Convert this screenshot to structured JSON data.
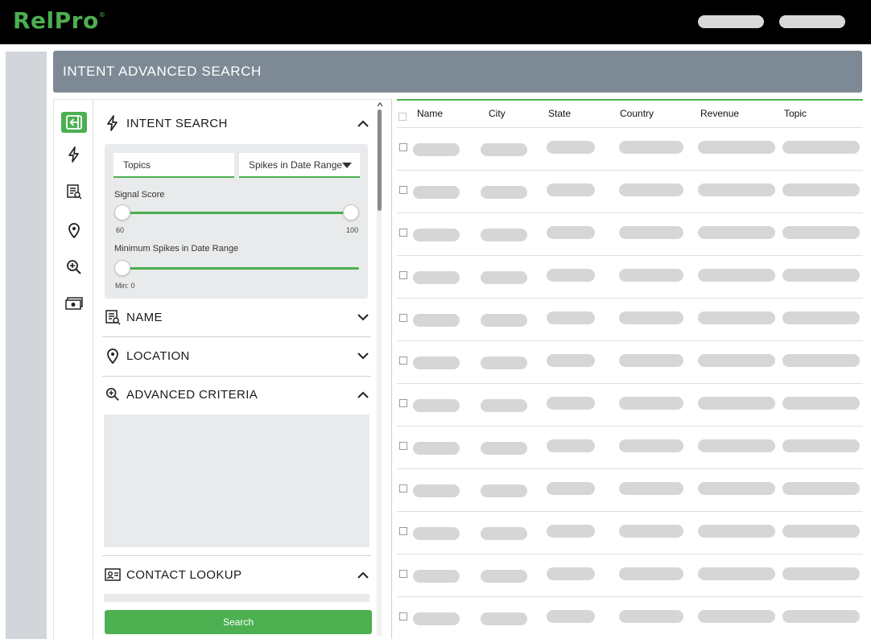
{
  "brand": {
    "name": "RelPro",
    "mark": "®",
    "color": "#4caf50"
  },
  "page": {
    "title": "INTENT ADVANCED SEARCH"
  },
  "rail": {
    "items": [
      {
        "icon": "collapse-panel-icon",
        "active": true
      },
      {
        "icon": "lightning-icon"
      },
      {
        "icon": "name-search-icon"
      },
      {
        "icon": "location-pin-icon"
      },
      {
        "icon": "zoom-in-icon"
      },
      {
        "icon": "money-icon"
      }
    ]
  },
  "sections": {
    "intent": {
      "title": "INTENT SEARCH",
      "icon": "lightning-icon",
      "expanded": true
    },
    "name": {
      "title": "NAME",
      "icon": "name-search-icon",
      "expanded": false
    },
    "location": {
      "title": "LOCATION",
      "icon": "location-pin-icon",
      "expanded": false
    },
    "advanced": {
      "title": "ADVANCED CRITERIA",
      "icon": "zoom-in-icon",
      "expanded": true
    },
    "contact": {
      "title": "CONTACT LOOKUP",
      "icon": "contact-card-icon",
      "expanded": true
    }
  },
  "intent_search": {
    "topics_value": "Topics",
    "date_range_value": "Spikes in Date Range",
    "signal_score_label": "Signal Score",
    "signal_min": "60",
    "signal_max": "100",
    "min_spikes_label": "Minimum Spikes in Date Range",
    "min_spikes_value": "Min: 0"
  },
  "search_button": "Search",
  "table": {
    "columns": [
      "Name",
      "City",
      "State",
      "Country",
      "Revenue",
      "Topic"
    ],
    "row_count": 12
  }
}
